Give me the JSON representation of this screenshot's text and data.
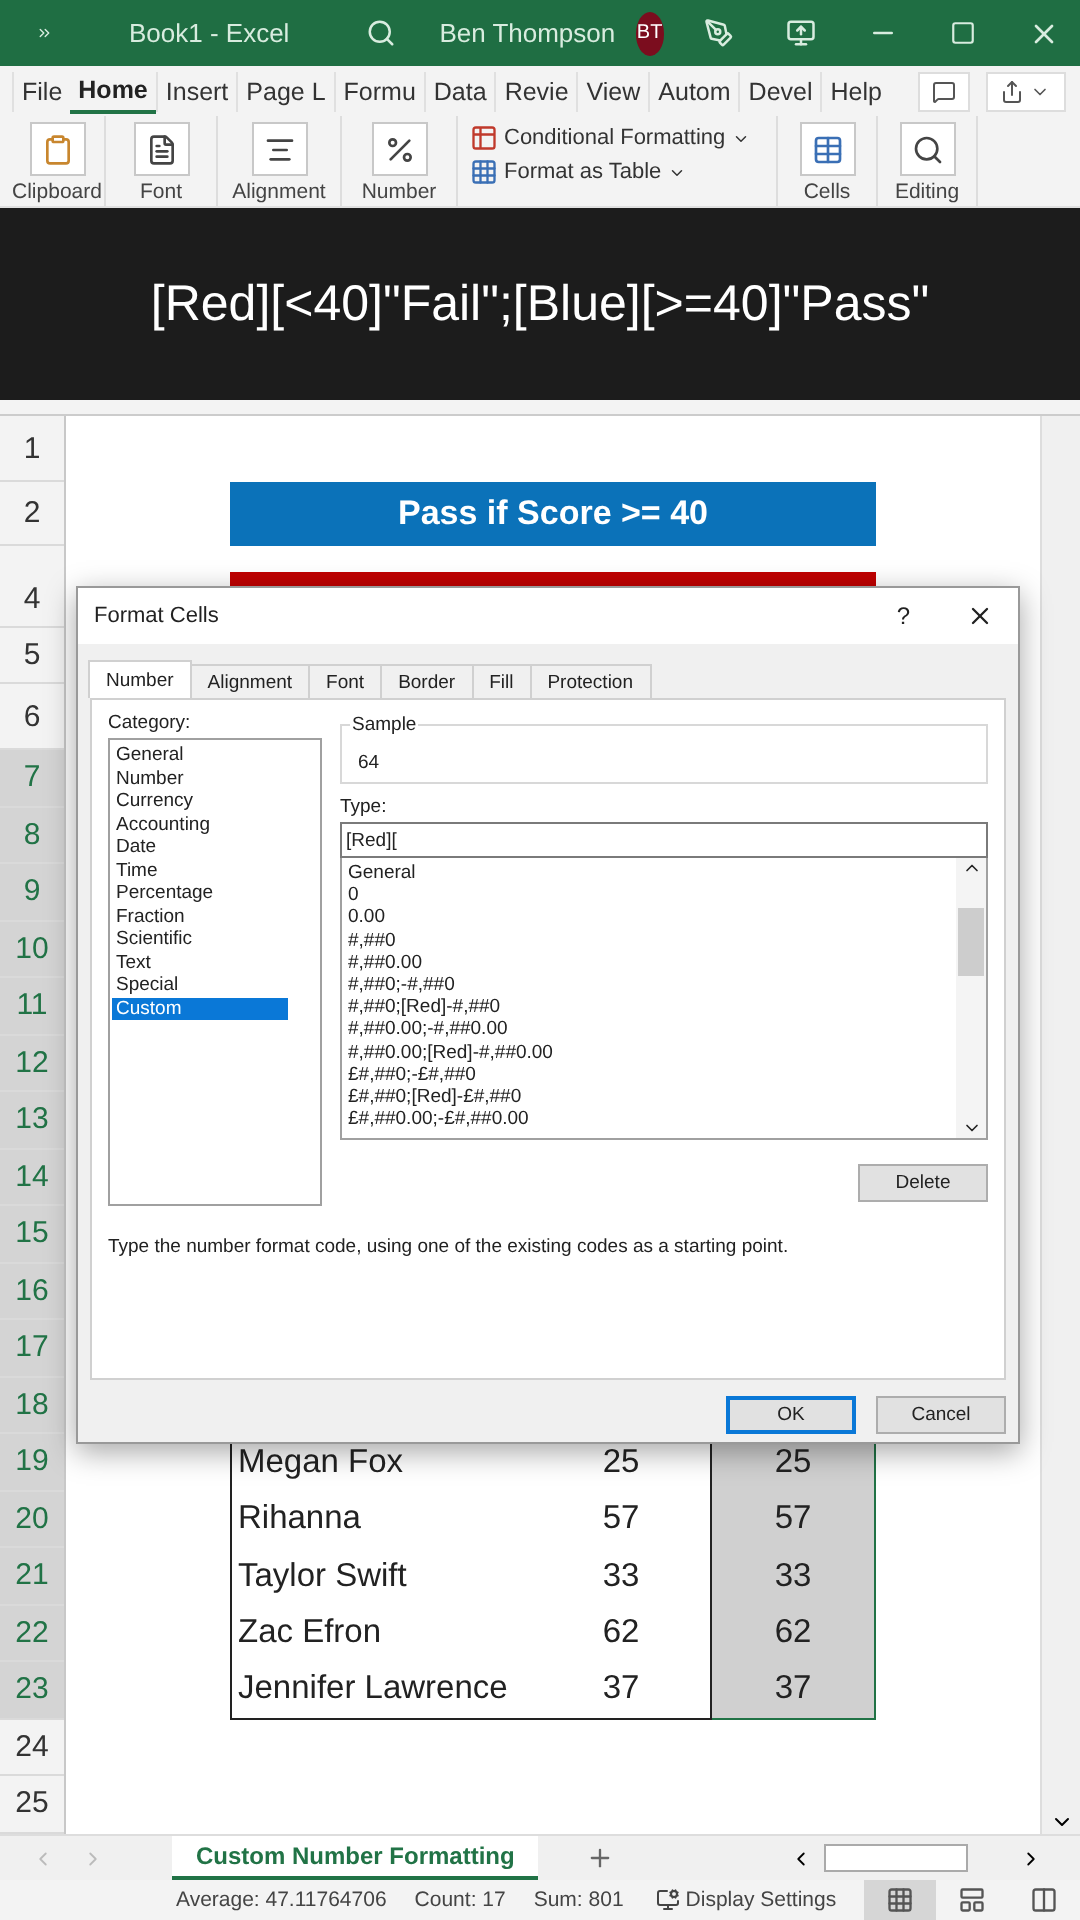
{
  "title_bar": {
    "title": "Book1  -  Excel",
    "user": "Ben Thompson",
    "initials": "BT"
  },
  "menu_tabs": [
    {
      "label": "File",
      "selected": false
    },
    {
      "label": "Home",
      "selected": true
    },
    {
      "label": "Insert",
      "selected": false
    },
    {
      "label": "Page L",
      "selected": false
    },
    {
      "label": "Formu",
      "selected": false
    },
    {
      "label": "Data",
      "selected": false
    },
    {
      "label": "Revie",
      "selected": false
    },
    {
      "label": "View",
      "selected": false
    },
    {
      "label": "Autom",
      "selected": false
    },
    {
      "label": "Devel",
      "selected": false
    },
    {
      "label": "Help",
      "selected": false
    }
  ],
  "ribbon": {
    "left_groups": [
      {
        "kind": "clipboard",
        "label": "Clipboard"
      },
      {
        "kind": "font",
        "label": "Font"
      },
      {
        "kind": "alignment",
        "label": "Alignment"
      },
      {
        "kind": "number",
        "label": "Number"
      }
    ],
    "styles": [
      {
        "kind": "conditional",
        "label": "Conditional Formatting"
      },
      {
        "kind": "table",
        "label": "Format as Table"
      }
    ],
    "right_groups": [
      {
        "kind": "cells",
        "label": "Cells"
      },
      {
        "kind": "editing",
        "label": "Editing"
      }
    ]
  },
  "caption": "[Red][<40]\"Fail\";[Blue][>=40]\"Pass\"",
  "row_headers": [
    {
      "label": "1",
      "selected": false
    },
    {
      "label": "2",
      "selected": false
    },
    {
      "label": "4",
      "selected": false
    },
    {
      "label": "5",
      "selected": false
    },
    {
      "label": "6",
      "selected": false
    },
    {
      "label": "7",
      "selected": true
    },
    {
      "label": "8",
      "selected": true
    },
    {
      "label": "9",
      "selected": true
    },
    {
      "label": "10",
      "selected": true
    },
    {
      "label": "11",
      "selected": true
    },
    {
      "label": "12",
      "selected": true
    },
    {
      "label": "13",
      "selected": true
    },
    {
      "label": "14",
      "selected": true
    },
    {
      "label": "15",
      "selected": true
    },
    {
      "label": "16",
      "selected": true
    },
    {
      "label": "17",
      "selected": true
    },
    {
      "label": "18",
      "selected": true
    },
    {
      "label": "19",
      "selected": true
    },
    {
      "label": "20",
      "selected": true
    },
    {
      "label": "21",
      "selected": true
    },
    {
      "label": "22",
      "selected": true
    },
    {
      "label": "23",
      "selected": true
    },
    {
      "label": "24",
      "selected": false
    },
    {
      "label": "25",
      "selected": false
    }
  ],
  "pass_header": "Pass if Score >= 40",
  "rows": [
    {
      "name": "Megan Fox",
      "score": "25",
      "value": "25",
      "selected": true
    },
    {
      "name": "Rihanna",
      "score": "57",
      "value": "57",
      "selected": true
    },
    {
      "name": "Taylor Swift",
      "score": "33",
      "value": "33",
      "selected": true
    },
    {
      "name": "Zac Efron",
      "score": "62",
      "value": "62",
      "selected": true
    },
    {
      "name": "Jennifer Lawrence",
      "score": "37",
      "value": "37",
      "selected": true
    }
  ],
  "dialog": {
    "title": "Format Cells",
    "help": "?",
    "tabs": [
      {
        "label": "Number",
        "selected": true
      },
      {
        "label": "Alignment",
        "selected": false
      },
      {
        "label": "Font",
        "selected": false
      },
      {
        "label": "Border",
        "selected": false
      },
      {
        "label": "Fill",
        "selected": false
      },
      {
        "label": "Protection",
        "selected": false
      }
    ],
    "category_label": "Category:",
    "categories": [
      {
        "label": "General",
        "selected": false
      },
      {
        "label": "Number",
        "selected": false
      },
      {
        "label": "Currency",
        "selected": false
      },
      {
        "label": "Accounting",
        "selected": false
      },
      {
        "label": "Date",
        "selected": false
      },
      {
        "label": "Time",
        "selected": false
      },
      {
        "label": "Percentage",
        "selected": false
      },
      {
        "label": "Fraction",
        "selected": false
      },
      {
        "label": "Scientific",
        "selected": false
      },
      {
        "label": "Text",
        "selected": false
      },
      {
        "label": "Special",
        "selected": false
      },
      {
        "label": "Custom",
        "selected": true
      }
    ],
    "sample_label": "Sample",
    "sample": "64",
    "type_label": "Type:",
    "type_value": "[Red][",
    "formats": [
      "General",
      "0",
      "0.00",
      "#,##0",
      "#,##0.00",
      "#,##0;-#,##0",
      "#,##0;[Red]-#,##0",
      "#,##0.00;-#,##0.00",
      "#,##0.00;[Red]-#,##0.00",
      "£#,##0;-£#,##0",
      "£#,##0;[Red]-£#,##0",
      "£#,##0.00;-£#,##0.00"
    ],
    "delete": "Delete",
    "description": "Type the number format code, using one of the existing codes as a starting point.",
    "ok": "OK",
    "cancel": "Cancel"
  },
  "sheet_tabs": [
    {
      "label": "Custom Number Formatting",
      "selected": true
    }
  ],
  "status_bar": {
    "stats": [
      "Average: 47.11764706",
      "Count: 17",
      "Sum: 801"
    ],
    "display_settings": "Display Settings",
    "views": [
      {
        "kind": "normal",
        "selected": true
      },
      {
        "kind": "page_layout",
        "selected": false
      },
      {
        "kind": "page_break",
        "selected": false
      }
    ]
  }
}
